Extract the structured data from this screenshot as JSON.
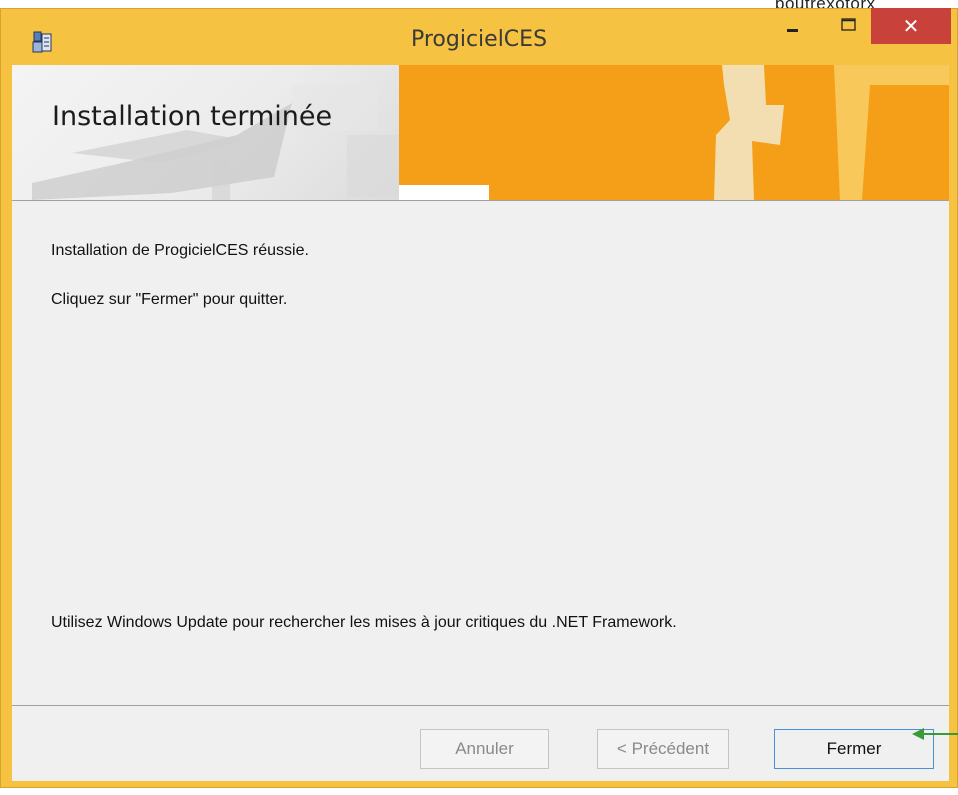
{
  "window": {
    "title": "ProgicielCES",
    "close_label": "✕"
  },
  "background": {
    "partial_text": "boutrexotorx"
  },
  "banner": {
    "title": "Installation terminée"
  },
  "content": {
    "line1": "Installation de ProgicielCES réussie.",
    "line2": "Cliquez sur \"Fermer\" pour quitter.",
    "line3": "Utilisez Windows Update pour rechercher les mises à jour critiques du .NET Framework."
  },
  "buttons": {
    "cancel": "Annuler",
    "back": "< Précédent",
    "close": "Fermer"
  },
  "colors": {
    "frame": "#f5c242",
    "close_button": "#c8423b",
    "banner_orange": "#f59f19",
    "focus_border": "#4a90d9",
    "annotation_arrow": "#3a9a3a"
  },
  "icons": {
    "app": "installer-icon",
    "minimize": "minimize-icon",
    "maximize": "maximize-icon",
    "close": "close-icon",
    "annotation": "arrow-left-icon"
  }
}
